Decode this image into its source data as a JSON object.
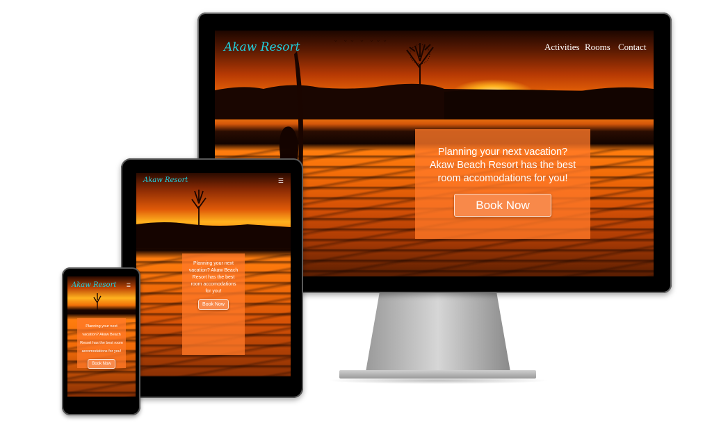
{
  "brand": {
    "logo": "Akaw Resort",
    "color": "#1fd2e0"
  },
  "nav": {
    "items": [
      {
        "label": "Activities"
      },
      {
        "label": "Rooms"
      },
      {
        "label": "Contact"
      }
    ],
    "menu_icon": "hamburger-icon"
  },
  "hero": {
    "message": "Planning your next vacation? Akaw Beach Resort has the best room accomodations for you!",
    "cta_label": "Book Now",
    "accent": "#ff7a2a"
  },
  "devices": [
    "desktop-monitor",
    "tablet",
    "phone"
  ]
}
